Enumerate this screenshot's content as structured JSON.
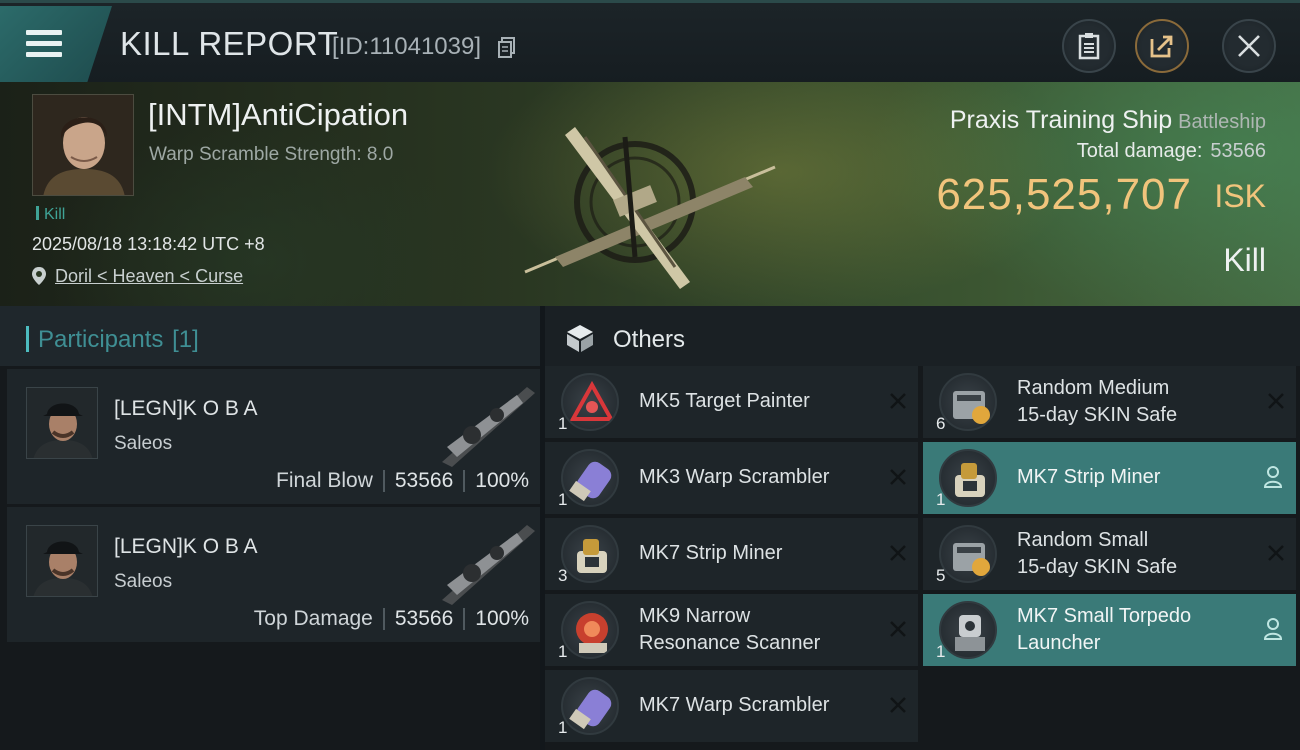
{
  "header": {
    "title": "KILL REPORT",
    "report_id": "[ID:11041039]",
    "icons": [
      "menu-icon",
      "copy-icon",
      "clipboard-icon",
      "share-icon",
      "close-icon"
    ]
  },
  "victim": {
    "name": "[INTM]AntiCipation",
    "warp_scramble": "Warp Scramble Strength: 8.0",
    "tag": "Kill",
    "datetime": "2025/08/18 13:18:42 UTC +8",
    "location": "Doril < Heaven < Curse",
    "ship_name": "Praxis Training Ship",
    "ship_class": "Battleship",
    "total_damage_label": "Total damage:",
    "total_damage": "53566",
    "isk_value": "625,525,707",
    "isk_unit": "ISK",
    "result": "Kill"
  },
  "participants": {
    "title": "Participants",
    "count": "[1]",
    "rows": [
      {
        "name": "[LEGN]K O B A",
        "ship": "Saleos",
        "label": "Final Blow",
        "damage": "53566",
        "percent": "100%"
      },
      {
        "name": "[LEGN]K O B A",
        "ship": "Saleos",
        "label": "Top Damage",
        "damage": "53566",
        "percent": "100%"
      }
    ]
  },
  "others": {
    "title": "Others",
    "left": [
      {
        "name": "MK5 Target Painter",
        "qty": "1",
        "icon": "target-painter-icon"
      },
      {
        "name": "MK3 Warp Scrambler",
        "qty": "1",
        "icon": "warp-scrambler-icon"
      },
      {
        "name": "MK7 Strip Miner",
        "qty": "3",
        "icon": "strip-miner-icon"
      },
      {
        "name": "MK9 Narrow Resonance Scanner",
        "line1": "MK9 Narrow",
        "line2": "Resonance Scanner",
        "qty": "1",
        "icon": "scanner-icon"
      },
      {
        "name": "MK7 Warp Scrambler",
        "qty": "1",
        "icon": "warp-scrambler-icon"
      }
    ],
    "right": [
      {
        "line1": "Random Medium",
        "line2": "15-day SKIN Safe",
        "qty": "6",
        "icon": "skin-safe-icon"
      },
      {
        "name": "MK7 Strip Miner",
        "qty": "1",
        "icon": "strip-miner-icon",
        "highlighted": true
      },
      {
        "line1": "Random Small",
        "line2": "15-day SKIN Safe",
        "qty": "5",
        "icon": "skin-safe-icon"
      },
      {
        "line1": "MK7 Small Torpedo",
        "line2": "Launcher",
        "qty": "1",
        "icon": "torpedo-launcher-icon",
        "highlighted": true
      }
    ]
  },
  "colors": {
    "accent_teal": "#3a7a78",
    "isk_gold": "#f1c47c",
    "kill_tag": "#3fa396"
  }
}
